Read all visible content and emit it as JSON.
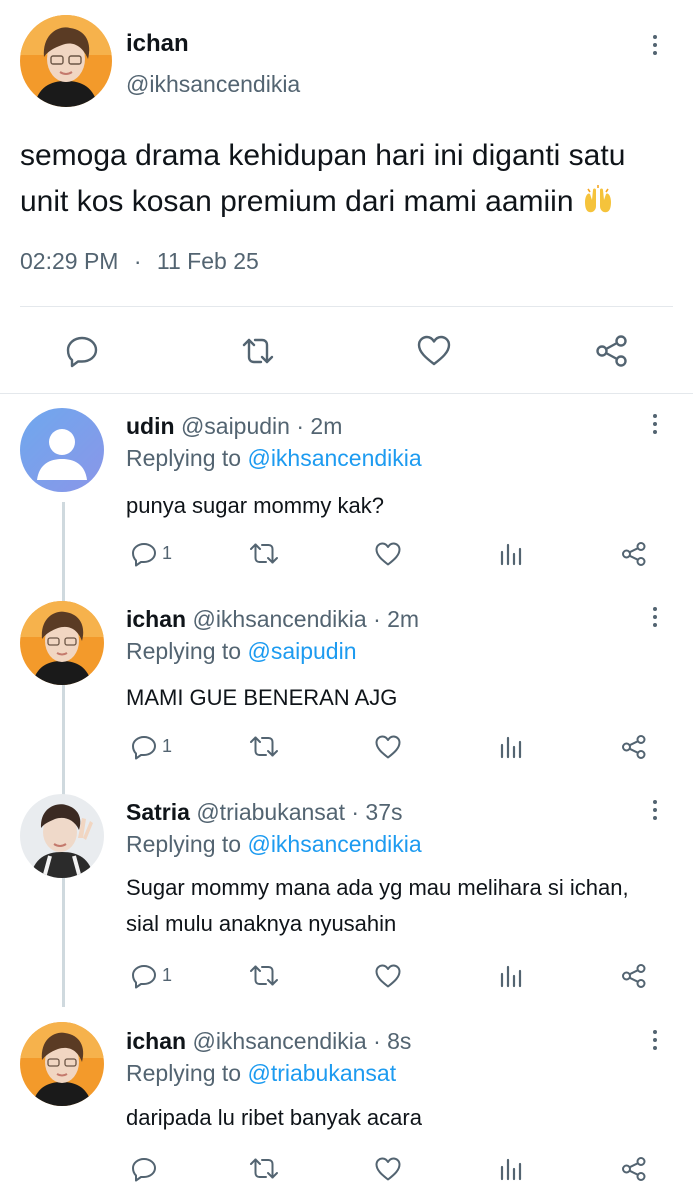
{
  "main_tweet": {
    "name": "ichan",
    "handle": "@ikhsancendikia",
    "text": "semoga drama kehidupan hari ini diganti satu unit kos kosan premium dari mami aamiin",
    "emoji": "raising-hands",
    "time": "02:29 PM",
    "separator": "·",
    "date": "11 Feb 25",
    "actions": [
      "reply-icon",
      "retweet-icon",
      "like-icon",
      "share-icon"
    ]
  },
  "replies": [
    {
      "name": "udin",
      "handle": "@saipudin · 2m",
      "replying_label": "Replying to",
      "replying_to": "@ikhsancendikia",
      "text": "punya sugar mommy kak?",
      "reply_count": "1",
      "avatar": "default-avatar"
    },
    {
      "name": "ichan",
      "handle": "@ikhsancendikia · 2m",
      "replying_label": "Replying to",
      "replying_to": "@saipudin",
      "text": "MAMI GUE BENERAN AJG",
      "reply_count": "1",
      "avatar": "photo-avatar"
    },
    {
      "name": "Satria",
      "handle": "@triabukansat · 37s",
      "replying_label": "Replying to",
      "replying_to": "@ikhsancendikia",
      "text": "Sugar mommy mana ada yg mau melihara si ichan, sial mulu anaknya nyusahin",
      "reply_count": "1",
      "avatar": "photo-avatar"
    },
    {
      "name": "ichan",
      "handle": "@ikhsancendikia · 8s",
      "replying_label": "Replying to",
      "replying_to": "@triabukansat",
      "text": "daripada lu ribet banyak acara",
      "reply_count": "",
      "avatar": "photo-avatar"
    }
  ],
  "colors": {
    "link": "#1d9bf0",
    "secondary": "#536471",
    "text": "#0f1419",
    "divider": "#e4e8ec"
  }
}
